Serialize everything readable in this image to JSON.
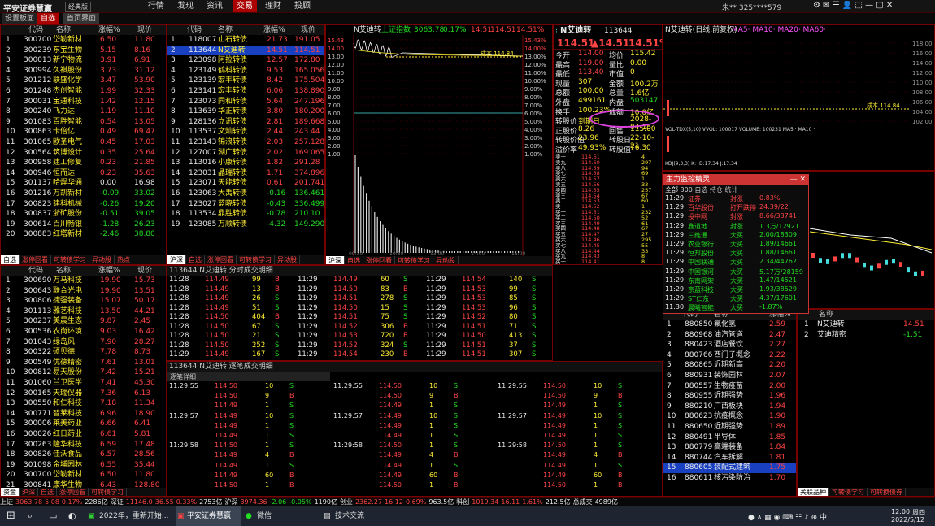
{
  "app": {
    "title": "平安证券慧赢",
    "badge": "经典版",
    "menus": [
      "行情",
      "发现",
      "资讯",
      "交易",
      "理财",
      "投顾"
    ],
    "user": "朱**  325****579",
    "tabs": [
      "设置板面",
      "自选",
      "首页界面"
    ]
  },
  "list1": {
    "headers": [
      "代码",
      "名称",
      "涨幅%",
      "现价"
    ],
    "rows": [
      [
        "1",
        "300700",
        "岱勒新材",
        "6.50",
        "11.80"
      ],
      [
        "2",
        "300239",
        "东宝生物",
        "5.15",
        "8.16"
      ],
      [
        "3",
        "300013",
        "新宁物流",
        "3.91",
        "6.91"
      ],
      [
        "4",
        "300994",
        "久祺股份",
        "3.73",
        "31.12"
      ],
      [
        "5",
        "301212",
        "联盛化学",
        "3.47",
        "53.90"
      ],
      [
        "6",
        "301248",
        "杰创智能",
        "1.99",
        "32.33"
      ],
      [
        "7",
        "300031",
        "宝通科技",
        "1.42",
        "12.15"
      ],
      [
        "8",
        "300240",
        "飞力达",
        "1.19",
        "11.10"
      ],
      [
        "9",
        "301083",
        "百胜智能",
        "0.54",
        "13.05"
      ],
      [
        "10",
        "300863",
        "卡倍亿",
        "0.49",
        "69.47"
      ],
      [
        "11",
        "301065",
        "欧圣电气",
        "0.45",
        "17.03"
      ],
      [
        "12",
        "300564",
        "筑博设计",
        "0.35",
        "25.64"
      ],
      [
        "13",
        "300958",
        "建工修复",
        "0.23",
        "21.85"
      ],
      [
        "14",
        "300946",
        "恒而达",
        "0.23",
        "35.63"
      ],
      [
        "15",
        "301137",
        "哈焊华通",
        "0.00",
        "16.98"
      ],
      [
        "16",
        "301216",
        "万凯新材",
        "-0.09",
        "33.02"
      ],
      [
        "17",
        "300823",
        "建科机械",
        "-0.26",
        "19.20"
      ],
      [
        "18",
        "300837",
        "浙矿股份",
        "-0.51",
        "39.05"
      ],
      [
        "19",
        "300614",
        "百川畅银",
        "-1.28",
        "26.23"
      ],
      [
        "20",
        "300883",
        "红塔新材",
        "-2.46",
        "38.80"
      ]
    ],
    "tabs": [
      "自选",
      "涨停回看",
      "可转债学习",
      "异动股",
      "热点"
    ]
  },
  "list2": {
    "headers": [
      "代码",
      "名称",
      "涨幅%",
      "现价"
    ],
    "rows": [
      [
        "1",
        "118007",
        "山石转债",
        "21.73",
        "191.05"
      ],
      [
        "2",
        "113644",
        "N艾迪转",
        "14.51",
        "114.51"
      ],
      [
        "3",
        "123098",
        "阿拉转债",
        "12.57",
        "172.80"
      ],
      [
        "4",
        "123149",
        "鹤科转债",
        "9.53",
        "165.056"
      ],
      [
        "5",
        "123139",
        "宏丰转债",
        "8.42",
        "175.504"
      ],
      [
        "6",
        "123141",
        "宏丰转债",
        "6.06",
        "138.890"
      ],
      [
        "7",
        "123073",
        "同和转债",
        "5.64",
        "247.196"
      ],
      [
        "8",
        "113639",
        "华正转债",
        "3.80",
        "180.200"
      ],
      [
        "9",
        "128136",
        "立讯转债",
        "2.81",
        "189.668"
      ],
      [
        "10",
        "113537",
        "文灿转债",
        "2.44",
        "243.44"
      ],
      [
        "11",
        "123143",
        "锦浪转债",
        "2.03",
        "257.128"
      ],
      [
        "12",
        "127007",
        "湖广转债",
        "2.02",
        "169.065"
      ],
      [
        "13",
        "113016",
        "小康转债",
        "1.82",
        "291.28"
      ],
      [
        "14",
        "123031",
        "晶瑞转债",
        "1.71",
        "374.896"
      ],
      [
        "15",
        "123071",
        "天能转债",
        "0.61",
        "201.741"
      ],
      [
        "16",
        "123063",
        "大禹转债",
        "-0.16",
        "136.461"
      ],
      [
        "17",
        "123027",
        "蓝晓转债",
        "-0.43",
        "336.499"
      ],
      [
        "18",
        "113534",
        "鼎胜转债",
        "-0.78",
        "210.10"
      ],
      [
        "19",
        "123085",
        "万顺转债",
        "-4.32",
        "149.290"
      ]
    ],
    "tabs": [
      "沪深",
      "自选",
      "涨停回看",
      "可转债学习",
      "异动股"
    ]
  },
  "list3": {
    "headers": [
      "代码",
      "名称",
      "涨幅%",
      "现价"
    ],
    "rows": [
      [
        "1",
        "300690",
        "万马科技",
        "19.90",
        "15.73"
      ],
      [
        "2",
        "300643",
        "联合光电",
        "19.90",
        "13.51"
      ],
      [
        "3",
        "300806",
        "捷强装备",
        "15.07",
        "50.17"
      ],
      [
        "4",
        "301113",
        "雅艺科技",
        "13.50",
        "44.21"
      ],
      [
        "5",
        "300237",
        "美晨生态",
        "9.87",
        "2.45"
      ],
      [
        "6",
        "300536",
        "农尚环境",
        "9.03",
        "16.42"
      ],
      [
        "7",
        "301043",
        "绿岛风",
        "7.90",
        "28.27"
      ],
      [
        "8",
        "300322",
        "硕贝德",
        "7.78",
        "8.73"
      ],
      [
        "9",
        "300549",
        "优德精密",
        "7.61",
        "13.01"
      ],
      [
        "10",
        "300812",
        "易天股份",
        "7.42",
        "15.21"
      ],
      [
        "11",
        "301060",
        "兰卫医学",
        "7.41",
        "45.30"
      ],
      [
        "12",
        "300165",
        "天瑞仪器",
        "7.36",
        "6.13"
      ],
      [
        "13",
        "300550",
        "和仁科技",
        "7.18",
        "11.34"
      ],
      [
        "14",
        "300771",
        "智莱科技",
        "6.96",
        "18.90"
      ],
      [
        "15",
        "300006",
        "莱美药业",
        "6.66",
        "6.41"
      ],
      [
        "16",
        "300026",
        "红日药业",
        "6.61",
        "5.81"
      ],
      [
        "17",
        "300263",
        "隆华科技",
        "6.59",
        "17.48"
      ],
      [
        "18",
        "300826",
        "佳沃食品",
        "6.57",
        "28.56"
      ],
      [
        "19",
        "301098",
        "金埔园林",
        "6.55",
        "35.44"
      ],
      [
        "20",
        "300700",
        "岱勒新材",
        "6.50",
        "11.80"
      ],
      [
        "21",
        "300841",
        "康华生物",
        "6.43",
        "128.80"
      ]
    ],
    "tabs": [
      "资金",
      "沪深",
      "自选",
      "涨停回看",
      "可转债学习"
    ]
  },
  "chart": {
    "name": "N艾迪转",
    "index": "上证指数",
    "index_val": "3063.78",
    "index_pct": "0.17%",
    "time": "14:51",
    "price": "114.51",
    "pct": "14.51%",
    "cost_label": "成本 114.84",
    "ylabels": [
      "15.43",
      "14.00",
      "13.00",
      "12.00",
      "11.00",
      "10.00",
      "9.00",
      "8.00",
      "7.00",
      "6.00",
      "5.00",
      "4.00",
      "3.00",
      "2.00",
      "1.00"
    ],
    "pct_labels": [
      "15.43%",
      "14.00%",
      "13.00%",
      "12.00%",
      "11.00%",
      "10.00%",
      "9.00%",
      "8.00%",
      "7.00%",
      "6.00%",
      "5.00%",
      "4.00%",
      "3.00%",
      "2.00%",
      "1.00%"
    ],
    "xlabels": [
      "09:30",
      "10:30",
      "13:00",
      "14:00",
      "15:00"
    ],
    "bottom_tabs": [
      "沪深",
      "自选",
      "涨停回看",
      "可转债学习",
      "异动股"
    ]
  },
  "quote": {
    "code": "113644",
    "name": "N艾迪转",
    "price": "114.51",
    "change": "▲14.51",
    "pct": "14.51%",
    "left": [
      [
        "今开",
        "114.00"
      ],
      [
        "最高",
        "119.00"
      ],
      [
        "最低",
        "113.40"
      ],
      [
        "现量",
        "307"
      ],
      [
        "总额",
        "100.00"
      ],
      [
        "外盘",
        "499161"
      ],
      [
        "换手",
        "100.23%"
      ],
      [
        "转股价",
        "到期日"
      ],
      [
        "正股价",
        "8.26"
      ],
      [
        "转股价值",
        "23.96"
      ],
      [
        "溢价率",
        "49.93%"
      ]
    ],
    "right": [
      [
        "均价",
        "115.42"
      ],
      [
        "量比",
        "0.00"
      ],
      [
        "市值",
        "0"
      ],
      [
        "金额",
        "100.2万"
      ],
      [
        "总量",
        "1.6亿"
      ],
      [
        "内盘",
        "503147"
      ],
      [
        "成额",
        "10.0亿"
      ],
      [
        "",
        "2028-04-15"
      ],
      [
        "回售",
        "115.00"
      ],
      [
        "转股日",
        "22-10-21"
      ],
      [
        "转股值",
        "76.30"
      ]
    ],
    "asks": [
      [
        "卖十",
        "114.61",
        "4"
      ],
      [
        "卖九",
        "114.60",
        "297"
      ],
      [
        "卖八",
        "114.59",
        "94"
      ],
      [
        "卖七",
        "114.58",
        "69"
      ],
      [
        "卖六",
        "114.57",
        "1"
      ],
      [
        "卖五",
        "114.56",
        "33"
      ],
      [
        "卖四",
        "114.55",
        "257"
      ],
      [
        "卖三",
        "114.54",
        "67"
      ],
      [
        "卖二",
        "114.53",
        "60"
      ],
      [
        "卖一",
        "114.52",
        "1"
      ]
    ],
    "bids": [
      [
        "买一",
        "114.51",
        "232"
      ],
      [
        "买二",
        "114.50",
        "52"
      ],
      [
        "买三",
        "114.49",
        "61"
      ],
      [
        "买四",
        "114.48",
        "67"
      ],
      [
        "买五",
        "114.47",
        "27"
      ],
      [
        "买六",
        "114.46",
        "295"
      ],
      [
        "买七",
        "114.45",
        "55"
      ],
      [
        "买八",
        "114.44",
        "33"
      ],
      [
        "买九",
        "114.43",
        "8"
      ],
      [
        "买十",
        "114.41",
        "8"
      ]
    ]
  },
  "kline": {
    "title": "N艾迪转(日线,前复权)",
    "ma": "MA5· MA10· MA20· MA60·",
    "cost": "成本 114.84",
    "vol": "VOL-TDX(5,10) VVOL: 100017 VOLUME: 100231 MA5 · MA10 ·",
    "kdj": "KDJ(9,3,3) K:· D:17.34 J:17.34",
    "ylabels": [
      "118.00",
      "116.00",
      "114.00",
      "112.00",
      "110.00",
      "108.00",
      "106.00",
      "104.00",
      "102.00"
    ]
  },
  "trades": {
    "title": "113644 N艾迪转  分时成交明细",
    "cols": [
      [
        [
          "11:28",
          "114.49",
          "99",
          "B"
        ],
        [
          "11:28",
          "114.49",
          "13",
          "B"
        ],
        [
          "11:28",
          "114.49",
          "26",
          "S"
        ],
        [
          "11:28",
          "114.49",
          "51",
          "S"
        ],
        [
          "11:28",
          "114.50",
          "404",
          "B"
        ],
        [
          "11:28",
          "114.50",
          "67",
          "S"
        ],
        [
          "11:28",
          "114.50",
          "21",
          "S"
        ],
        [
          "11:28",
          "114.50",
          "252",
          "S"
        ],
        [
          "11:29",
          "114.49",
          "167",
          "S"
        ]
      ],
      [
        [
          "11:29",
          "114.49",
          "60",
          "S"
        ],
        [
          "11:29",
          "114.50",
          "83",
          "B"
        ],
        [
          "11:29",
          "114.51",
          "278",
          "S"
        ],
        [
          "11:29",
          "114.50",
          "15",
          "S"
        ],
        [
          "11:29",
          "114.51",
          "75",
          "S"
        ],
        [
          "11:29",
          "114.52",
          "306",
          "B"
        ],
        [
          "11:29",
          "114.53",
          "720",
          "B"
        ],
        [
          "11:29",
          "114.52",
          "324",
          "S"
        ],
        [
          "11:29",
          "114.54",
          "230",
          "B"
        ]
      ],
      [
        [
          "11:29",
          "114.54",
          "140",
          "S"
        ],
        [
          "11:29",
          "114.53",
          "99",
          "S"
        ],
        [
          "11:29",
          "114.53",
          "85",
          "S"
        ],
        [
          "11:29",
          "114.53",
          "96",
          "S"
        ],
        [
          "11:29",
          "114.52",
          "80",
          "S"
        ],
        [
          "11:29",
          "114.51",
          "71",
          "S"
        ],
        [
          "11:29",
          "114.50",
          "413",
          "S"
        ],
        [
          "11:29",
          "114.51",
          "37",
          "S"
        ],
        [
          "11:29",
          "114.51",
          "307",
          "S"
        ]
      ]
    ]
  },
  "detail": {
    "title": "113644 N艾迪转 逐笔成交明细",
    "sub": "逐笔详细",
    "rows": [
      [
        "11:29:55",
        "114.50",
        "10",
        "S"
      ],
      [
        "",
        "114.50",
        "9",
        "B"
      ],
      [
        "",
        "114.49",
        "1",
        "S"
      ],
      [
        "11:29:57",
        "114.49",
        "10",
        "S"
      ],
      [
        "",
        "114.49",
        "1",
        "S"
      ],
      [
        "",
        "114.49",
        "1",
        "S"
      ],
      [
        "11:29:58",
        "114.50",
        "1",
        "S"
      ],
      [
        "",
        "114.49",
        "4",
        "B"
      ],
      [
        "",
        "114.49",
        "1",
        "S"
      ],
      [
        "",
        "114.49",
        "60",
        "B"
      ],
      [
        "",
        "114.50",
        "1",
        "B"
      ]
    ]
  },
  "monitor": {
    "title": "主力监控精灵",
    "tabs": [
      "全部",
      "300",
      "自选",
      "持仓",
      "统计"
    ],
    "rows": [
      [
        "11:29",
        "证券",
        "封涨",
        "0.83%"
      ],
      [
        "11:29",
        "百华股份",
        "打开跌停",
        "24.39/22"
      ],
      [
        "11:29",
        "投中网",
        "封涨",
        "8.66/33741"
      ],
      [
        "11:29",
        "鑫道地",
        "封涨",
        "1.3万/12921"
      ],
      [
        "11:29",
        "三维通",
        "大买",
        "2.00/18309"
      ],
      [
        "11:29",
        "农业银行",
        "大买",
        "1.89/14661"
      ],
      [
        "11:29",
        "恒邦股份",
        "大买",
        "1.88/14661"
      ],
      [
        "11:29",
        "中国联通",
        "大买",
        "2.34/44762"
      ],
      [
        "11:29",
        "中国银河",
        "大买",
        "5.17万/28159"
      ],
      [
        "11:29",
        "东南网架",
        "大买",
        "1.47/14521"
      ],
      [
        "11:29",
        "京蓝科技",
        "大买",
        "1.93/38529"
      ],
      [
        "11:29",
        "ST仁东",
        "大买",
        "4.37/17601"
      ],
      [
        "11:30",
        "晨曦智能",
        "大买",
        "-1.87%"
      ]
    ]
  },
  "sectors": {
    "headers": [
      "代码",
      "名称",
      "涨幅%"
    ],
    "rows": [
      [
        "1",
        "880850",
        "氟化氢",
        "2.59"
      ],
      [
        "2",
        "880968",
        "油汽管道",
        "2.47"
      ],
      [
        "3",
        "880423",
        "酒店餐饮",
        "2.27"
      ],
      [
        "4",
        "880766",
        "西门子概念",
        "2.22"
      ],
      [
        "5",
        "880865",
        "近期新高",
        "2.20"
      ],
      [
        "6",
        "880931",
        "装饰园林",
        "2.07"
      ],
      [
        "7",
        "880557",
        "生物疫苗",
        "2.00"
      ],
      [
        "8",
        "880955",
        "近期强势",
        "1.96"
      ],
      [
        "9",
        "880210",
        "广西板块",
        "1.94"
      ],
      [
        "10",
        "880623",
        "抗疫概念",
        "1.90"
      ],
      [
        "11",
        "880650",
        "近期强势",
        "1.89"
      ],
      [
        "12",
        "880491",
        "半导体",
        "1.85"
      ],
      [
        "13",
        "880779",
        "高端装备",
        "1.84"
      ],
      [
        "14",
        "880744",
        "汽车拆解",
        "1.81"
      ],
      [
        "15",
        "880605",
        "装配式建筑",
        "1.75"
      ],
      [
        "16",
        "880611",
        "核污染防治",
        "1.70"
      ]
    ],
    "right": [
      [
        "1",
        "N艾迪转",
        "14.51"
      ],
      [
        "2",
        "艾迪精密",
        "-1.51"
      ]
    ],
    "tabs": [
      "关联品种",
      "可转债学习",
      "可转换债券"
    ]
  },
  "statusbar": [
    "上证",
    "3063.78",
    "5.08",
    "0.17%",
    "2286亿",
    "深证",
    "11146.0",
    "36.55",
    "0.33%",
    "2753亿",
    "沪深",
    "3974.36",
    "-2.06",
    "-0.05%",
    "1190亿",
    "创业",
    "2362.27",
    "16.12",
    "0.69%",
    "963.5亿",
    "科创",
    "1019.34",
    "16.11",
    "1.61%",
    "212.5亿",
    "总成交",
    "4989亿"
  ],
  "taskbar": {
    "items": [
      "2022年，重新开始...",
      "平安证券慧赢V8.2...",
      "微信",
      "技术交流"
    ],
    "time": "12:00",
    "date": "2022/5/12",
    "day": "周四"
  }
}
